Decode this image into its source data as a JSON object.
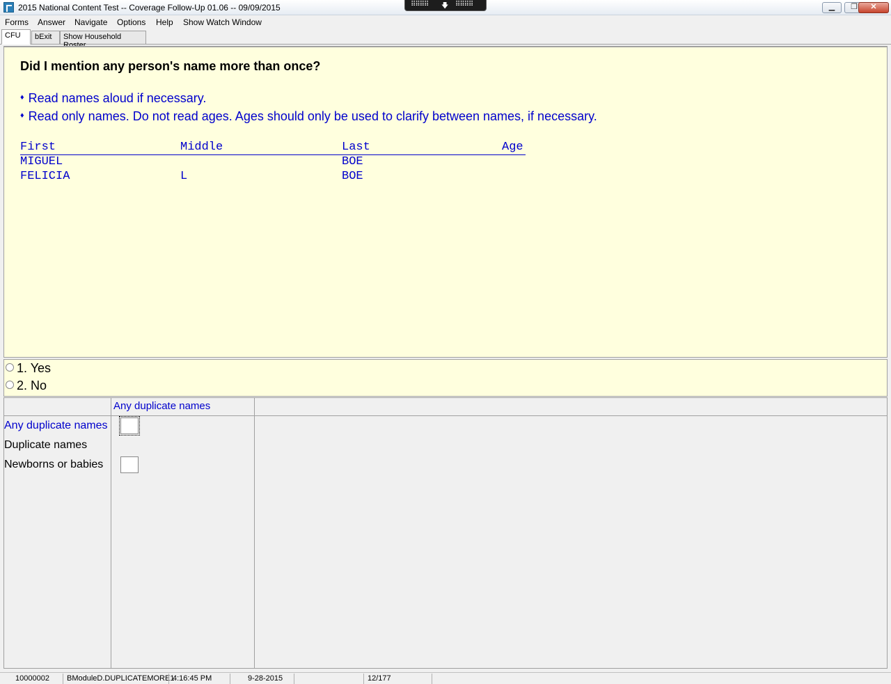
{
  "window": {
    "title": "2015 National Content Test -- Coverage Follow-Up 01.06 -- 09/09/2015",
    "remote_toolbar_left": "⠿⠿⠿⠿",
    "remote_toolbar_center": "🡇",
    "remote_toolbar_right": "⠿⠿⠿⠿",
    "minimize_glyph": "▁",
    "restore_glyph": "❐",
    "close_glyph": "✕"
  },
  "menu": {
    "items": [
      "Forms",
      "Answer",
      "Navigate",
      "Options",
      "Help",
      "Show Watch Window"
    ]
  },
  "tabs": [
    "CFU",
    "bExit",
    "Show Household Roster"
  ],
  "question": {
    "text": "Did I mention any person's name more than once?",
    "instructions": [
      "Read names aloud if necessary.",
      "Read only names. Do not read ages. Ages should only be used to clarify between names, if necessary."
    ],
    "bullet": "♦"
  },
  "roster": {
    "headers": {
      "first": "First",
      "middle": "Middle",
      "last": "Last",
      "age": "Age"
    },
    "rows": [
      {
        "first": "MIGUEL",
        "middle": "",
        "last": "BOE",
        "age": ""
      },
      {
        "first": "FELICIA",
        "middle": "L",
        "last": "BOE",
        "age": ""
      }
    ]
  },
  "answers": {
    "options": [
      "1. Yes",
      "2. No"
    ]
  },
  "grid": {
    "column_header": "Any duplicate names",
    "rows": [
      {
        "label": "Any duplicate names",
        "value": ""
      },
      {
        "label": "Duplicate names"
      },
      {
        "label": "Newborns or babies",
        "value": ""
      }
    ]
  },
  "status": {
    "case_id": "10000002",
    "field": "BModuleD.DUPLICATEMORE1",
    "time": "4:16:45 PM",
    "date": "9-28-2015",
    "empty": "",
    "page": "12/177"
  },
  "colors": {
    "panel_bg": "#ffffde",
    "instruction_text": "#0000cc",
    "chrome_bg": "#f0f0f0"
  }
}
